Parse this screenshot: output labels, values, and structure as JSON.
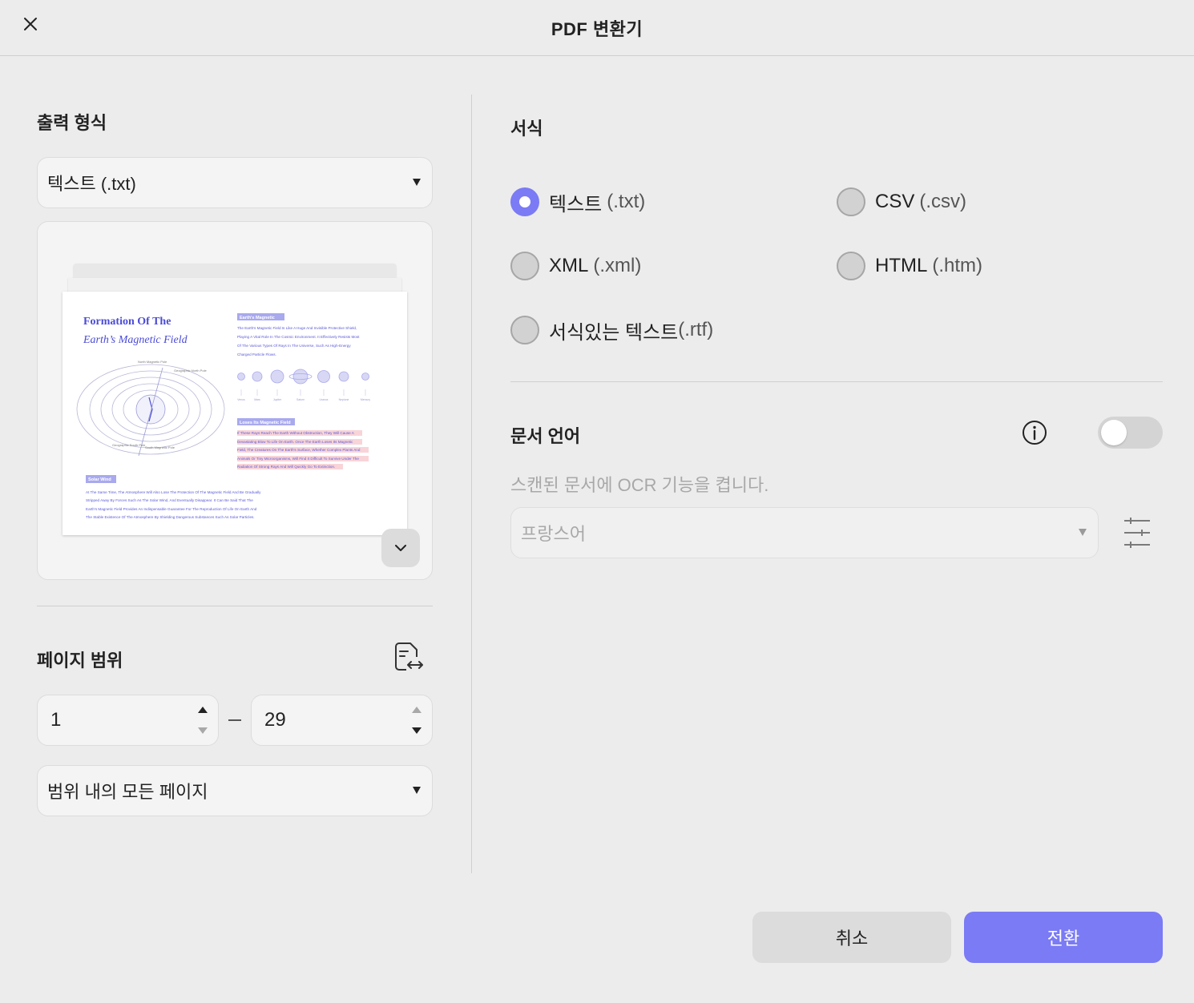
{
  "window": {
    "title": "PDF 변환기"
  },
  "left": {
    "output_format_title": "출력 형식",
    "output_format_value": "텍스트 (.txt)",
    "preview": {
      "doc_title_line1": "Formation Of The",
      "doc_title_line2": "Earth’s Magnetic Field",
      "tag_magnetic": "Earth's Magnetic",
      "tag_loses": "Loses Its Magnetic Field",
      "tag_solar": "Solar Wind",
      "label_north": "North Magnetic Pole",
      "label_geo_north": "Geographic North Pole",
      "label_geo_south": "Geographic South Pole",
      "label_south": "South Magnetic Pole",
      "planets": [
        "Venus",
        "Mars",
        "Jupiter",
        "Saturn",
        "Uranus",
        "Neptune",
        "Mercury"
      ],
      "para_magnetic": [
        "The Earth's Magnetic Field Is Like A Huge And Invisible Protective Shield,",
        "Playing A Vital Role In The Cosmic Environment. It Effectively Resists Most",
        "Of The Various Types Of Rays In The Universe, Such As High-Energy",
        "Charged Particle Flows."
      ],
      "para_loses": [
        "If These Rays Reach The Earth Without Obstruction, They Will Cause A",
        "Devastating Blow To Life On Earth. Once The Earth Loses Its Magnetic",
        "Field, The Creatures On The Earth's Surface, Whether Complex Plants And",
        "Animals Or Tiny Microorganisms, Will Find It Difficult To Survive Under The",
        "Radiation Of Strong Rays And Will Quickly Go To Extinction."
      ],
      "para_solar": [
        "At The Same Time, The Atmosphere Will Also Lose The Protection Of The Magnetic Field And Be Gradually",
        "Stripped Away By Forces Such As The Solar Wind, And Eventually Disappear. It Can Be Said That The",
        "Earth's Magnetic Field Provides An Indispensable Guarantee For The Reproduction Of Life On Earth And",
        "The Stable Existence Of The Atmosphere By Shielding Dangerous Substances Such As Solar Particles."
      ]
    },
    "page_range_title": "페이지 범위",
    "range_from": "1",
    "range_to": "29",
    "page_subset_value": "범위 내의 모든 페이지"
  },
  "right": {
    "format_title": "서식",
    "formats": [
      {
        "label": "텍스트",
        "ext": "(.txt)",
        "checked": true
      },
      {
        "label": "CSV",
        "ext": "(.csv)",
        "checked": false
      },
      {
        "label": "XML",
        "ext": "(.xml)",
        "checked": false
      },
      {
        "label": "HTML",
        "ext": "(.htm)",
        "checked": false
      },
      {
        "label": "서식있는 텍스트",
        "ext": "(.rtf)",
        "checked": false
      }
    ],
    "doc_language_title": "문서 언어",
    "ocr_hint": "스캔된 문서에 OCR 기능을 켭니다.",
    "ocr_enabled": false,
    "language_value": "프랑스어"
  },
  "footer": {
    "cancel_label": "취소",
    "convert_label": "전환"
  },
  "colors": {
    "accent": "#7b7bf5",
    "background": "#ececec"
  },
  "icons": {
    "close": "close-icon",
    "expand": "chevron-down-icon",
    "page_range": "page-swap-icon",
    "info": "info-icon",
    "ocr_settings": "sliders-icon"
  }
}
